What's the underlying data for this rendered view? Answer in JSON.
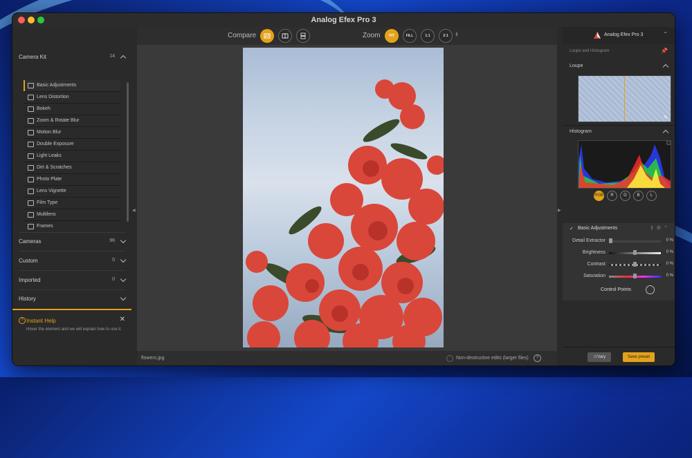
{
  "window": {
    "title": "Analog Efex Pro 3"
  },
  "left_panel": {
    "camera_kit": {
      "label": "Camera Kit",
      "count": "14"
    },
    "filters": [
      "Basic Adjustments",
      "Lens Distortion",
      "Bokeh",
      "Zoom & Rotate Blur",
      "Motion Blur",
      "Double Exposure",
      "Light Leaks",
      "Dirt & Scratches",
      "Photo Plate",
      "Lens Vignette",
      "Film Type",
      "Multilens",
      "Frames"
    ],
    "cameras": {
      "label": "Cameras",
      "count": "96"
    },
    "custom": {
      "label": "Custom",
      "count": "0"
    },
    "imported": {
      "label": "Imported",
      "count": "0"
    },
    "history": {
      "label": "History"
    },
    "instant_help": {
      "title": "Instant Help",
      "body": "Hover the element and we will explain how to use it."
    }
  },
  "toolbar": {
    "compare_label": "Compare",
    "zoom_label": "Zoom",
    "zoom_options": [
      "FIT",
      "FILL",
      "1:1",
      "2:1"
    ],
    "zoom_selected": "FIT"
  },
  "status_bar": {
    "filename": "flowers.jpg",
    "nondestructive_label": "Non-destructive edits (larger files)"
  },
  "right_panel": {
    "app_name": "Analog Efex Pro 3",
    "loupe_histogram_label": "Loupe and Histogram",
    "loupe_label": "Loupe",
    "histogram_label": "Histogram",
    "channels": [
      "RGB",
      "R",
      "G",
      "B",
      "L"
    ],
    "channel_selected": "RGB",
    "basic_adjustments_label": "Basic Adjustments",
    "sliders": [
      {
        "name": "Detail Extractor",
        "value": "0 %",
        "level": 0.0
      },
      {
        "name": "Brightness",
        "value": "0 %",
        "level": 0.5
      },
      {
        "name": "Contrast",
        "value": "0 %",
        "level": 0.5
      },
      {
        "name": "Saturation",
        "value": "0 %",
        "level": 0.5
      }
    ],
    "control_points_label": "Control Points",
    "vary_label": "Vary",
    "save_preset_label": "Save preset"
  },
  "colors": {
    "accent": "#e4a21b",
    "panel": "#2a2a2a",
    "canvas": "#3a3a3a"
  }
}
